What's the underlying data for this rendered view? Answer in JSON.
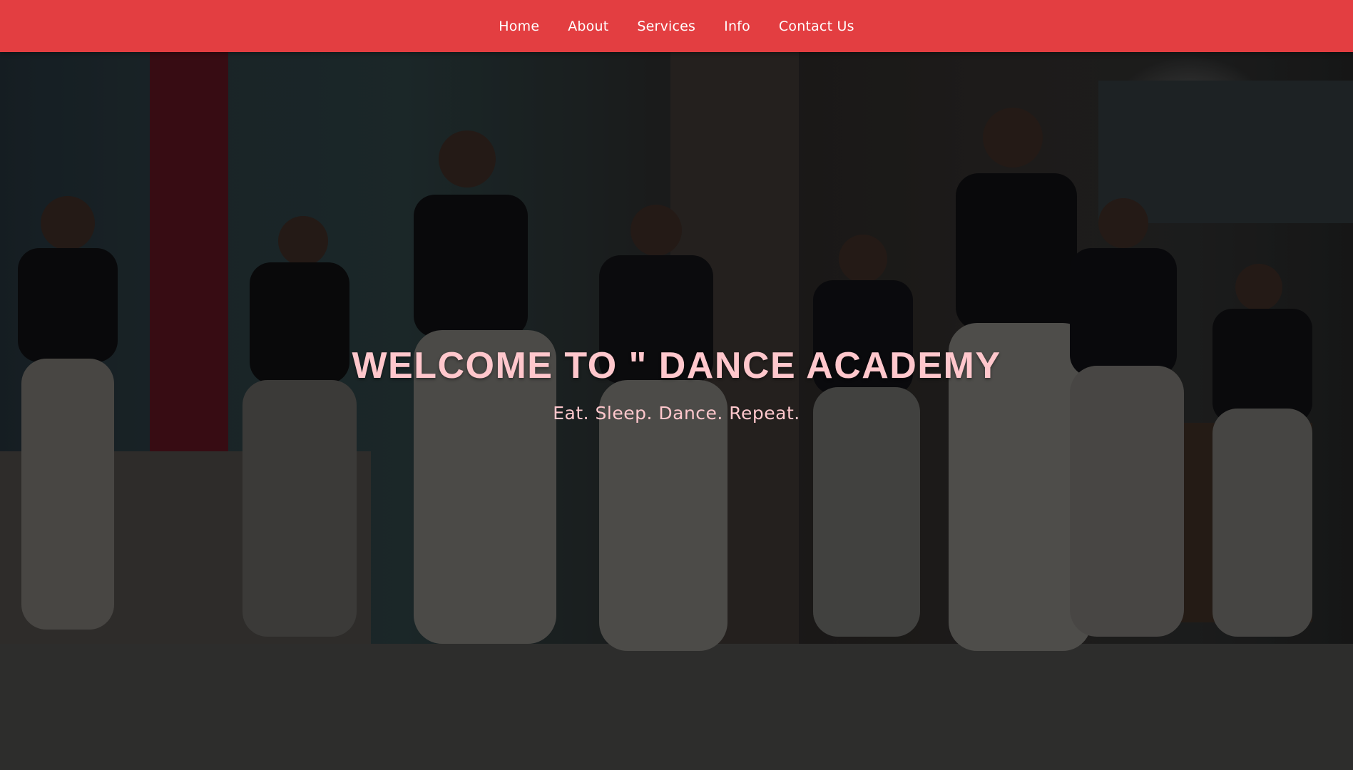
{
  "nav": {
    "items": [
      {
        "label": "Home"
      },
      {
        "label": "About"
      },
      {
        "label": "Services"
      },
      {
        "label": "Info"
      },
      {
        "label": "Contact Us"
      }
    ],
    "background_color": "#e33e41",
    "text_color": "#ffffff"
  },
  "hero": {
    "title": "WELCOME TO \" DANCE ACADEMY",
    "subtitle": "Eat. Sleep. Dance. Repeat.",
    "text_color": "#ffc7cc",
    "background_image": "group-of-dancers-on-stage-photo"
  }
}
